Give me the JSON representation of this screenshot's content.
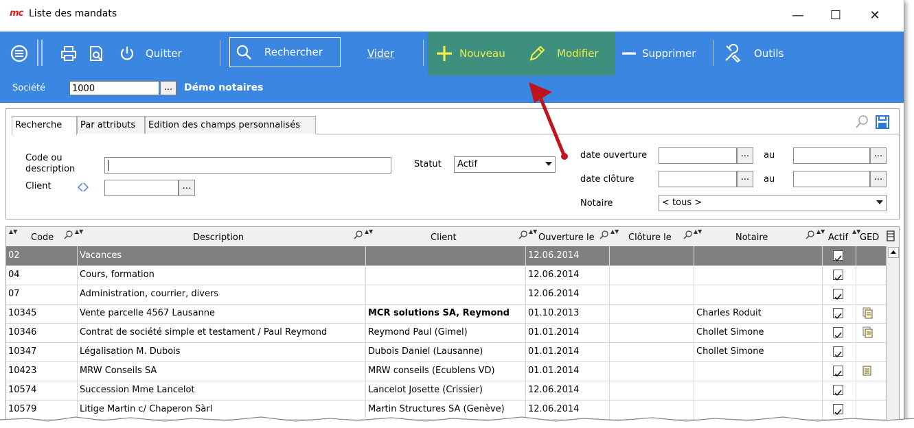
{
  "window": {
    "logo": "mc",
    "title": "Liste des mandats",
    "minimize": "—",
    "maximize": "☐",
    "close": "✕"
  },
  "toolbar": {
    "quit": "Quitter",
    "search": "Rechercher",
    "clear": "Vider",
    "new": "Nouveau",
    "edit": "Modifier",
    "delete": "Supprimer",
    "tools": "Outils"
  },
  "society": {
    "label": "Société",
    "value": "1000",
    "button": "...",
    "name": "Démo notaires"
  },
  "tabs": [
    "Recherche",
    "Par attributs",
    "Edition des champs personnalisés"
  ],
  "filters": {
    "code_label_1": "Code ou",
    "code_label_2": "description",
    "code_value": "",
    "client_label": "Client",
    "client_value": "",
    "status_label": "Statut",
    "status_value": "Actif",
    "open_date_label": "date ouverture",
    "close_date_label": "date clôture",
    "to_label": "au",
    "notary_label": "Notaire",
    "notary_value": "< tous >",
    "button": "..."
  },
  "columns": {
    "code": "Code",
    "description": "Description",
    "client": "Client",
    "opened": "Ouverture le",
    "closed": "Clôture le",
    "notary": "Notaire",
    "active": "Actif",
    "ged": "GED"
  },
  "rows": [
    {
      "code": "02",
      "description": "Vacances",
      "client": "",
      "opened": "12.06.2014",
      "closed": "",
      "notary": "",
      "active": true,
      "ged": ""
    },
    {
      "code": "04",
      "description": "Cours, formation",
      "client": "",
      "opened": "12.06.2014",
      "closed": "",
      "notary": "",
      "active": true,
      "ged": ""
    },
    {
      "code": "07",
      "description": "Administration, courrier, divers",
      "client": "",
      "opened": "12.06.2014",
      "closed": "",
      "notary": "",
      "active": true,
      "ged": ""
    },
    {
      "code": "10345",
      "description": "Vente parcelle 4567 Lausanne",
      "client": "MCR solutions SA, Reymond",
      "opened": "01.10.2013",
      "closed": "",
      "notary": "Charles Roduit",
      "active": true,
      "ged": "multi"
    },
    {
      "code": "10346",
      "description": "Contrat de société simple et testament / Paul Reymond",
      "client": "Reymond Paul (Gimel)",
      "opened": "01.01.2014",
      "closed": "",
      "notary": "Chollet Simone",
      "active": true,
      "ged": "multi"
    },
    {
      "code": "10347",
      "description": "Légalisation M. Dubois",
      "client": "Dubois Daniel (Lausanne)",
      "opened": "01.01.2014",
      "closed": "",
      "notary": "Chollet Simone",
      "active": true,
      "ged": ""
    },
    {
      "code": "10423",
      "description": "MRW Conseils SA",
      "client": "MRW conseils (Ecublens VD)",
      "opened": "01.01.2014",
      "closed": "",
      "notary": "",
      "active": true,
      "ged": "single"
    },
    {
      "code": "10574",
      "description": "Succession Mme Lancelot",
      "client": "Lancelot Josette (Crissier)",
      "opened": "12.06.2014",
      "closed": "",
      "notary": "",
      "active": true,
      "ged": ""
    },
    {
      "code": "10579",
      "description": "Litige Martin c/ Chaperon Sàrl",
      "client": "Martin Structures SA (Genève)",
      "opened": "12.06.2014",
      "closed": "",
      "notary": "",
      "active": true,
      "ged": ""
    }
  ],
  "colors": {
    "toolbar": "#3a86e0",
    "highlight": "#3e8f7e",
    "accent_green": "#f0f04a",
    "arrow": "#c0141c",
    "selected_row": "#808080"
  }
}
